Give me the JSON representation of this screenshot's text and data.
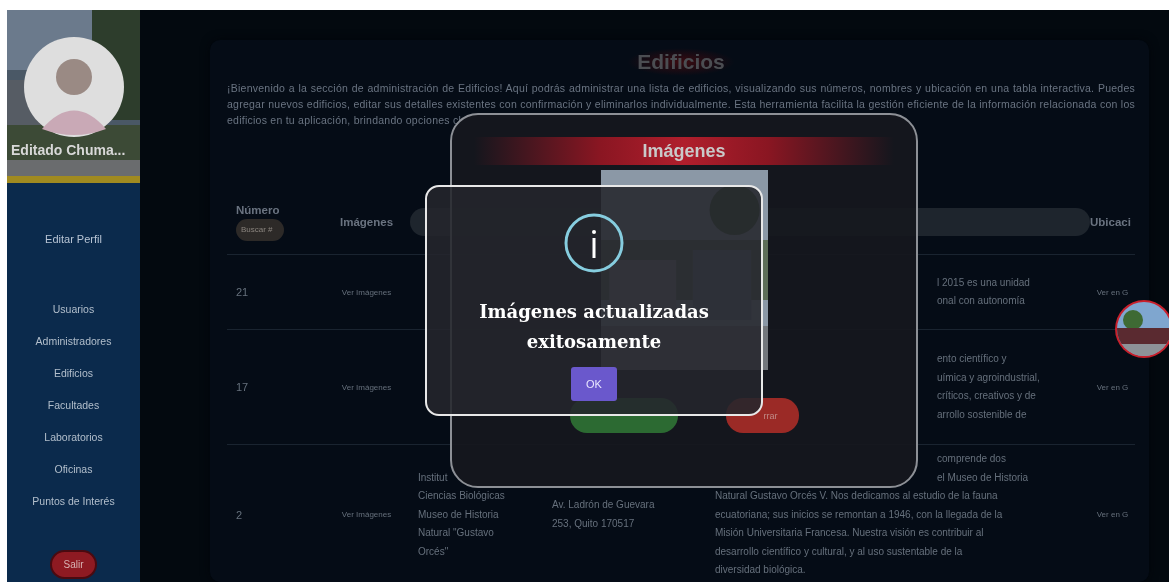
{
  "sidebar": {
    "user_name": "Editado Chuma...",
    "profile_link": "Editar Perfil",
    "items": [
      "Usuarios",
      "Administradores",
      "Edificios",
      "Facultades",
      "Laboratorios",
      "Oficinas",
      "Puntos de Interés"
    ],
    "logout": "Salir"
  },
  "page": {
    "title": "Edificios",
    "intro": "¡Bienvenido a la sección de administración de Edificios! Aquí podrás administrar una lista de edificios, visualizando sus números, nombres y ubicación en una tabla interactiva. Puedes agregar nuevos edificios, editar sus detalles existentes con confirmación y eliminarlos individualmente. Esta herramienta facilita la gestión eficiente de la información relacionada con los edificios en tu aplicación, brindando opciones cl"
  },
  "table": {
    "columns": [
      {
        "label": "Número"
      },
      {
        "label": "Imágenes"
      },
      {
        "label": "Ubicaci"
      }
    ],
    "number_search": {
      "placeholder": "Buscar #"
    },
    "rows": [
      {
        "number": "21",
        "images_link": "Ver Imágenes",
        "name_lines": [],
        "address_lines": [],
        "description_lines": [
          {
            "text": "l 2015 es una unidad",
            "clipped": true
          },
          {
            "text": "onal con autonomía",
            "clipped": true
          }
        ],
        "location_link": "Ver en G"
      },
      {
        "number": "17",
        "images_link": "Ver Imágenes",
        "name_lines": [],
        "address_lines": [],
        "description_lines": [
          {
            "text": "ento científico y",
            "clipped": true
          },
          {
            "text": "uímica y agroindustrial,",
            "clipped": true
          },
          {
            "text": "críticos, creativos y de",
            "clipped": true
          },
          {
            "text": "arrollo sostenible de",
            "clipped": true
          }
        ],
        "location_link": "Ver en G"
      },
      {
        "number": "2",
        "images_link": "Ver Imágenes",
        "name_lines": [
          "Institut",
          "Ciencias Biológicas",
          "Museo de Historia",
          "Natural \"Gustavo",
          "Orcés\""
        ],
        "address_lines": [
          "Av. Ladrón de Guevara",
          "253, Quito 170517"
        ],
        "description_lines": [
          {
            "text": "comprende dos",
            "clipped": true
          },
          {
            "text": "el Museo de Historia",
            "clipped": true
          },
          {
            "text": "Natural Gustavo Orcés V. Nos dedicamos al estudio de la fauna"
          },
          {
            "text": "ecuatoriana; sus inicios se remontan a 1946, con la llegada de la"
          },
          {
            "text": "Misión Universitaria Francesa. Nuestra visión es contribuir al"
          },
          {
            "text": "desarrollo científico y cultural, y al uso sustentable de la"
          },
          {
            "text": "diversidad biológica."
          }
        ],
        "location_link": "Ver en G"
      }
    ]
  },
  "images_modal": {
    "title": "Imágenes",
    "close_button": "rrar"
  },
  "alert": {
    "message": "Imágenes actualizadas exitosamente",
    "ok_button": "OK"
  }
}
